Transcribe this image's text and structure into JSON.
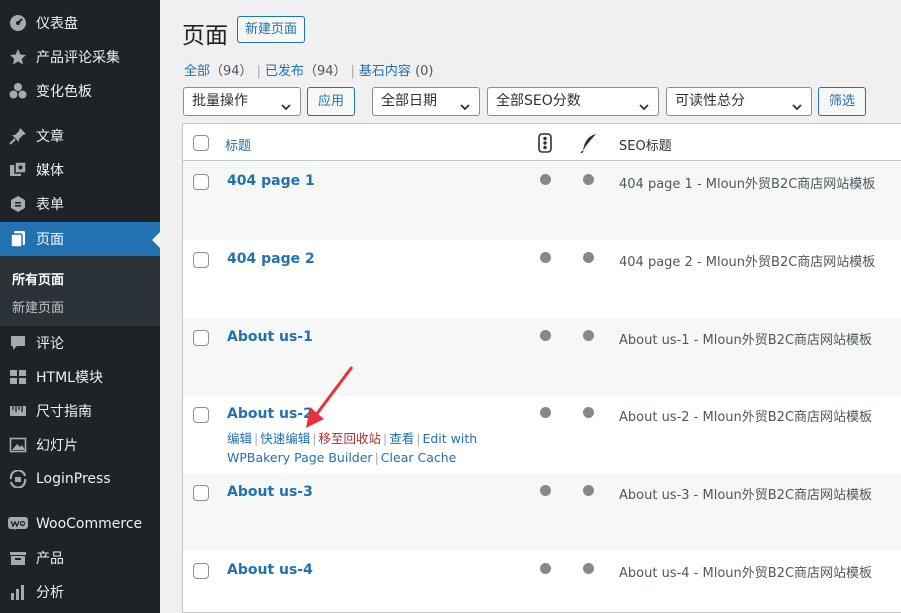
{
  "sidebar": {
    "items": [
      {
        "label": "仪表盘",
        "icon": "dashboard-icon"
      },
      {
        "label": "产品评论采集",
        "icon": "star-icon"
      },
      {
        "label": "变化色板",
        "icon": "palette-icon"
      },
      {
        "label": "文章",
        "icon": "pin-icon"
      },
      {
        "label": "媒体",
        "icon": "media-icon"
      },
      {
        "label": "表单",
        "icon": "form-icon"
      },
      {
        "label": "页面",
        "icon": "pages-icon"
      },
      {
        "label": "评论",
        "icon": "comment-icon"
      },
      {
        "label": "HTML模块",
        "icon": "html-block-icon"
      },
      {
        "label": "尺寸指南",
        "icon": "ruler-icon"
      },
      {
        "label": "幻灯片",
        "icon": "slides-icon"
      },
      {
        "label": "LoginPress",
        "icon": "loginpress-icon"
      },
      {
        "label": "WooCommerce",
        "icon": "woocommerce-icon"
      },
      {
        "label": "产品",
        "icon": "product-icon"
      },
      {
        "label": "分析",
        "icon": "analytics-icon"
      }
    ],
    "submenu": [
      "所有页面",
      "新建页面"
    ]
  },
  "header": {
    "title": "页面",
    "add_new": "新建页面"
  },
  "filters": {
    "all_label": "全部",
    "all_count": "（94）",
    "published_label": "已发布",
    "published_count": "（94）",
    "cornerstone_label": "基石内容",
    "cornerstone_count": "(0)",
    "bulk_action": "批量操作",
    "apply": "应用",
    "dates": "全部日期",
    "seo_scores": "全部SEO分数",
    "readability": "可读性总分",
    "filter": "筛选"
  },
  "table": {
    "col_title": "标题",
    "col_seo": "SEO标题",
    "rows": [
      {
        "title": "404 page 1",
        "seo": "404 page 1 - Mloun外贸B2C商店网站模板"
      },
      {
        "title": "404 page 2",
        "seo": "404 page 2 - Mloun外贸B2C商店网站模板"
      },
      {
        "title": "About us-1",
        "seo": "About us-1 - Mloun外贸B2C商店网站模板"
      },
      {
        "title": "About us-2",
        "seo": "About us-2 - Mloun外贸B2C商店网站模板"
      },
      {
        "title": "About us-3",
        "seo": "About us-3 - Mloun外贸B2C商店网站模板"
      },
      {
        "title": "About us-4",
        "seo": "About us-4 - Mloun外贸B2C商店网站模板"
      }
    ],
    "row_actions": {
      "edit": "编辑",
      "quick_edit": "快速编辑",
      "trash": "移至回收站",
      "view": "查看",
      "wpbakery": "Edit with WPBakery Page Builder",
      "clear_cache": "Clear Cache"
    }
  },
  "colors": {
    "sidebar_bg": "#1d2327",
    "accent": "#2271b1",
    "arrow": "#e8323a",
    "trash": "#b32d2e"
  }
}
